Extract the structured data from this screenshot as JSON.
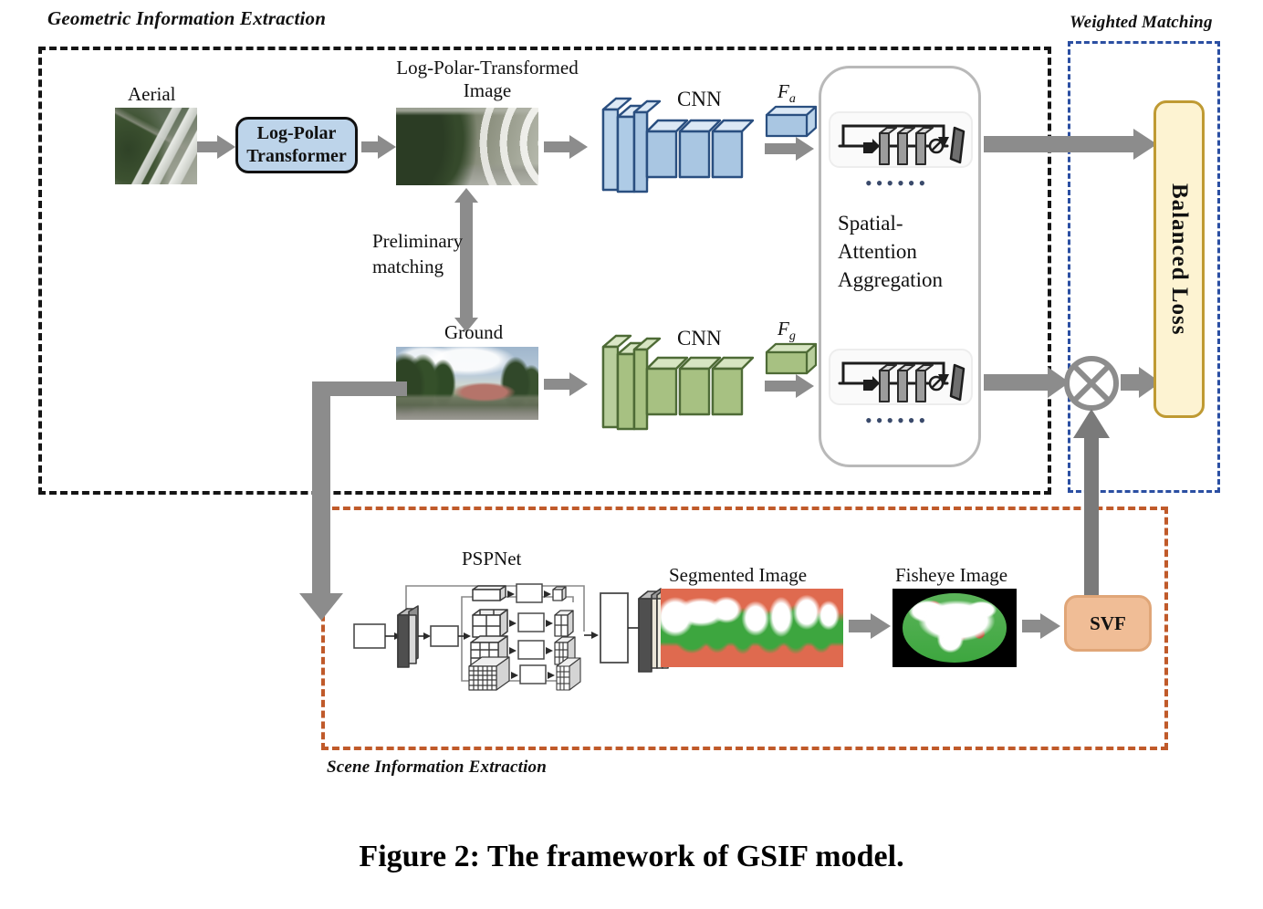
{
  "figure": {
    "caption": "Figure 2: The framework of GSIF model."
  },
  "sections": {
    "geometric": {
      "title": "Geometric Information Extraction",
      "border_color": "#151515"
    },
    "weighted": {
      "title": "Weighted Matching",
      "border_color": "#2b4fa2"
    },
    "scene": {
      "title": "Scene Information Extraction",
      "border_color": "#c05a2a"
    }
  },
  "geometric_branch": {
    "aerial": {
      "label": "Aerial",
      "transformer_label_line1": "Log-Polar",
      "transformer_label_line2": "Transformer",
      "transformed_label_line1": "Log-Polar-Transformed",
      "transformed_label_line2": "Image",
      "cnn_label": "CNN",
      "feature_label": "Fa",
      "feature_base": "F",
      "feature_sub": "a",
      "color": "#a9c6e2"
    },
    "ground": {
      "label": "Ground",
      "cnn_label": "CNN",
      "feature_label": "Fg",
      "feature_base": "F",
      "feature_sub": "g",
      "color": "#a7c182"
    },
    "preliminary_matching": {
      "line1": "Preliminary",
      "line2": "matching"
    },
    "attention": {
      "title_line1": "Spatial-",
      "title_line2": "Attention",
      "title_line3": "Aggregation",
      "dots": "••••••"
    }
  },
  "weighted_matching": {
    "balanced_loss_label": "Balanced Loss",
    "multiply_symbol": "⊗",
    "box_fill": "#fdf3d2",
    "box_border": "#bf9a33"
  },
  "scene_branch": {
    "pspnet_label": "PSPNet",
    "segmented_label": "Segmented Image",
    "fisheye_label": "Fisheye Image",
    "svf_label": "SVF",
    "svf_fill": "#f0bd96"
  },
  "palette": {
    "arrow_gray": "#8c8c8c",
    "thick_gray": "#7a7a7a",
    "aerial_blue": "#a9c6e2",
    "aerial_blue_dark": "#2a4f80",
    "ground_green": "#a7c182",
    "ground_green_dark": "#4e6b36",
    "segment_red": "#df6a4f",
    "segment_green": "#3da63f"
  }
}
